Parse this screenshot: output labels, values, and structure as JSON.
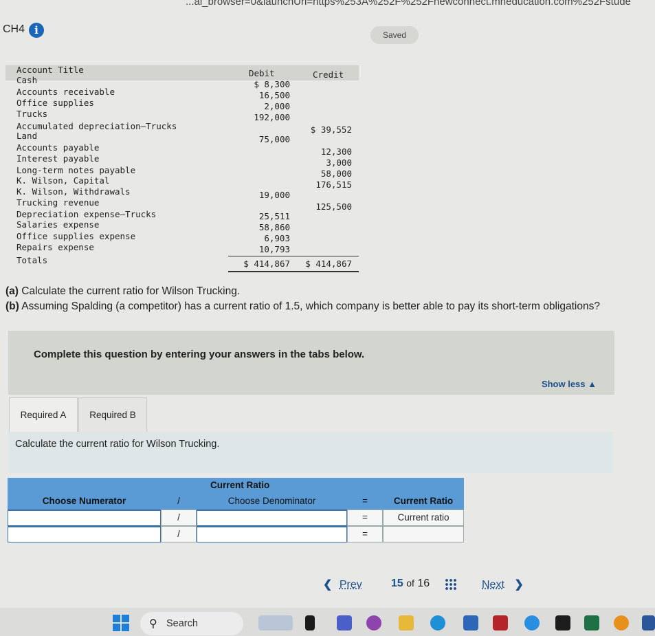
{
  "browser": {
    "url_fragment": "...al_browser=0&launchUrl=https%253A%252F%252Fnewconnect.mheducation.com%252Fstude"
  },
  "header": {
    "title": "CH4",
    "info_icon": "info-icon",
    "saved_label": "Saved"
  },
  "trial_balance": {
    "col_account": "Account Title",
    "col_debit": "Debit",
    "col_credit": "Credit",
    "accounts": [
      "Cash",
      "Accounts receivable",
      "Office supplies",
      "Trucks",
      "Accumulated depreciation—Trucks",
      "Land",
      "Accounts payable",
      "Interest payable",
      "Long-term notes payable",
      "K. Wilson, Capital",
      "K. Wilson, Withdrawals",
      "Trucking revenue",
      "Depreciation expense—Trucks",
      "Salaries expense",
      "Office supplies expense",
      "Repairs expense",
      "Totals"
    ],
    "debits": [
      "$ 8,300",
      "16,500",
      "2,000",
      "192,000",
      "75,000",
      "19,000",
      "25,511",
      "58,860",
      "6,903",
      "10,793"
    ],
    "credits": [
      "$ 39,552",
      "12,300",
      "3,000",
      "58,000",
      "176,515",
      "125,500"
    ],
    "total_debit": "$ 414,867",
    "total_credit": "$ 414,867"
  },
  "question": {
    "a_tag": "(a)",
    "a_text": " Calculate the current ratio for Wilson Trucking.",
    "b_tag": "(b)",
    "b_text": " Assuming Spalding (a competitor) has a current ratio of 1.5, which company is better able to pay its short-term obligations?"
  },
  "instruction_panel": {
    "message": "Complete this question by entering your answers in the tabs below.",
    "show_less": "Show less ▲"
  },
  "tabs": [
    {
      "label": "Required A",
      "active": true
    },
    {
      "label": "Required B",
      "active": false
    }
  ],
  "tab_content": {
    "prompt": "Calculate the current ratio for Wilson Trucking."
  },
  "ratio_table": {
    "title": "Current Ratio",
    "numerator_header": "Choose Numerator",
    "slash": "/",
    "denominator_header": "Choose Denominator",
    "equals": "=",
    "result_header": "Current Ratio",
    "result_label": "Current ratio",
    "numerator_value": "",
    "denominator_value": "",
    "result_value": ""
  },
  "pagination": {
    "prev": "Prev",
    "current": "15",
    "of": "of",
    "total": "16",
    "next": "Next",
    "prev_icon": "chevron-left-icon",
    "next_icon": "chevron-right-icon",
    "grid_icon": "grid-icon"
  },
  "taskbar": {
    "search_label": "Search",
    "search_icon": "search-icon",
    "start_icon": "windows-start-icon"
  },
  "colors": {
    "accent_blue": "#5b9bd5",
    "link_blue": "#1d4f8a",
    "panel_gray": "#d3d5cf",
    "info_blue": "#1a66b8"
  }
}
